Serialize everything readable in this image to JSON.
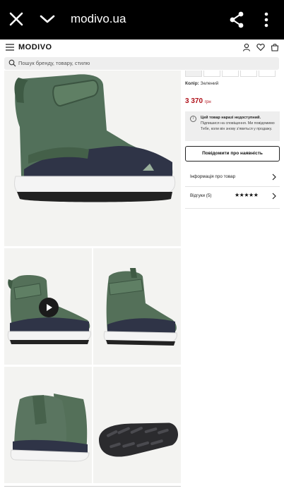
{
  "browser": {
    "url": "modivo.ua"
  },
  "header": {
    "logo": "MODIVO"
  },
  "search": {
    "placeholder": "Пошук бренду, товару, стилю"
  },
  "product": {
    "color_label": "Колір:",
    "color_value": "Зелений",
    "price_value": "3 370",
    "price_currency": "грн",
    "notice_title": "Цей товар наразі недоступний.",
    "notice_text": "Підпишися на сповіщення. Ми повідомимо Тебе, коли він знову з'явиться у продажу.",
    "notify_button": "Повідомити про наявність",
    "info_link": "Інформація про товар",
    "reviews_link": "Відгуки (5)",
    "rating_stars": "★★★★★"
  },
  "colors": {
    "price": "#b0121b",
    "boot_green": "#4f6b52",
    "boot_navy": "#2f3447"
  }
}
